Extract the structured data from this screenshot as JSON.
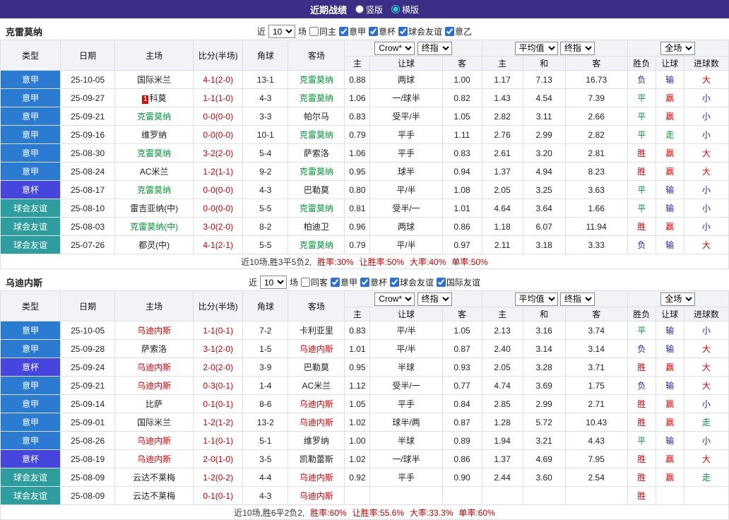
{
  "colors": {
    "topbar_bg": "#3A2E86",
    "type_league": "#2B7BD3",
    "type_cup": "#4646DE",
    "type_friendly": "#2E9D9D",
    "score": "#CC0000",
    "win": "#E60000",
    "draw": "#009933",
    "lose": "#2323CC",
    "focus_section1": "#009933",
    "focus_section2": "#E60000",
    "summary_stat": "#CC0000"
  },
  "topbar": {
    "title": "近期战绩",
    "layout_options": [
      {
        "label": "竖版",
        "selected": false
      },
      {
        "label": "横版",
        "selected": true
      }
    ]
  },
  "table_header": {
    "type": "类型",
    "date": "日期",
    "home": "主场",
    "score": "比分(半场)",
    "corner": "角球",
    "away": "客场",
    "selects": {
      "bookmaker": "Crow*",
      "final1": "终指",
      "average": "平均值",
      "final2": "终指",
      "scope": "全场"
    },
    "sub": [
      "主",
      "让球",
      "客",
      "主",
      "和",
      "客",
      "胜负",
      "让球",
      "进球数"
    ]
  },
  "sections": [
    {
      "team": "克雷莫纳",
      "focus_color_key": "focus_section1",
      "filter": {
        "near": "近",
        "count": "10",
        "games": "场",
        "venue": {
          "label": "同主",
          "checked": false
        },
        "leagues": [
          {
            "label": "意甲",
            "checked": true
          },
          {
            "label": "意杯",
            "checked": true
          },
          {
            "label": "球会友谊",
            "checked": true
          },
          {
            "label": "意乙",
            "checked": true
          }
        ]
      },
      "rows": [
        {
          "type": "意甲",
          "tkey": "league",
          "date": "25-10-05",
          "home": "国际米兰",
          "home_focus": false,
          "badge": "",
          "score": "4-1(2-0)",
          "corner": "13-1",
          "away": "克雷莫纳",
          "away_focus": true,
          "odds": [
            "0.88",
            "两球",
            "1.00",
            "1.17",
            "7.13",
            "16.73"
          ],
          "results": [
            [
              "负",
              "lose"
            ],
            [
              "输",
              "lose"
            ],
            [
              "大",
              "win"
            ]
          ]
        },
        {
          "type": "意甲",
          "tkey": "league",
          "date": "25-09-27",
          "home": "科莫",
          "home_focus": false,
          "badge": "1",
          "score": "1-1(1-0)",
          "corner": "4-3",
          "away": "克雷莫纳",
          "away_focus": true,
          "odds": [
            "1.06",
            "一/球半",
            "0.82",
            "1.43",
            "4.54",
            "7.39"
          ],
          "results": [
            [
              "平",
              "draw"
            ],
            [
              "赢",
              "win"
            ],
            [
              "小",
              "lose"
            ]
          ]
        },
        {
          "type": "意甲",
          "tkey": "league",
          "date": "25-09-21",
          "home": "克雷莫纳",
          "home_focus": true,
          "badge": "",
          "score": "0-0(0-0)",
          "corner": "3-3",
          "away": "帕尔马",
          "away_focus": false,
          "odds": [
            "0.83",
            "受平/半",
            "1.05",
            "2.82",
            "3.11",
            "2.66"
          ],
          "results": [
            [
              "平",
              "draw"
            ],
            [
              "赢",
              "win"
            ],
            [
              "小",
              "lose"
            ]
          ]
        },
        {
          "type": "意甲",
          "tkey": "league",
          "date": "25-09-16",
          "home": "维罗纳",
          "home_focus": false,
          "badge": "",
          "score": "0-0(0-0)",
          "corner": "10-1",
          "away": "克雷莫纳",
          "away_focus": true,
          "odds": [
            "0.79",
            "平手",
            "1.11",
            "2.76",
            "2.99",
            "2.82"
          ],
          "results": [
            [
              "平",
              "draw"
            ],
            [
              "走",
              "draw"
            ],
            [
              "小",
              "lose"
            ]
          ]
        },
        {
          "type": "意甲",
          "tkey": "league",
          "date": "25-08-30",
          "home": "克雷莫纳",
          "home_focus": true,
          "badge": "",
          "score": "3-2(2-0)",
          "corner": "5-4",
          "away": "萨索洛",
          "away_focus": false,
          "odds": [
            "1.06",
            "平手",
            "0.83",
            "2.61",
            "3.20",
            "2.81"
          ],
          "results": [
            [
              "胜",
              "win"
            ],
            [
              "赢",
              "win"
            ],
            [
              "大",
              "win"
            ]
          ]
        },
        {
          "type": "意甲",
          "tkey": "league",
          "date": "25-08-24",
          "home": "AC米兰",
          "home_focus": false,
          "badge": "",
          "score": "1-2(1-1)",
          "corner": "9-2",
          "away": "克雷莫纳",
          "away_focus": true,
          "odds": [
            "0.95",
            "球半",
            "0.94",
            "1.37",
            "4.94",
            "8.23"
          ],
          "results": [
            [
              "胜",
              "win"
            ],
            [
              "赢",
              "win"
            ],
            [
              "大",
              "win"
            ]
          ]
        },
        {
          "type": "意杯",
          "tkey": "cup",
          "date": "25-08-17",
          "home": "克雷莫纳",
          "home_focus": true,
          "badge": "",
          "score": "0-0(0-0)",
          "corner": "4-3",
          "away": "巴勒莫",
          "away_focus": false,
          "odds": [
            "0.80",
            "平/半",
            "1.08",
            "2.05",
            "3.25",
            "3.63"
          ],
          "results": [
            [
              "平",
              "draw"
            ],
            [
              "输",
              "lose"
            ],
            [
              "小",
              "lose"
            ]
          ]
        },
        {
          "type": "球会友谊",
          "tkey": "friendly",
          "date": "25-08-10",
          "home": "雷吉亚纳(中)",
          "home_focus": false,
          "badge": "",
          "score": "0-0(0-0)",
          "corner": "5-5",
          "away": "克雷莫纳",
          "away_focus": true,
          "odds": [
            "0.81",
            "受半/一",
            "1.01",
            "4.64",
            "3.64",
            "1.66"
          ],
          "results": [
            [
              "平",
              "draw"
            ],
            [
              "输",
              "lose"
            ],
            [
              "小",
              "lose"
            ]
          ]
        },
        {
          "type": "球会友谊",
          "tkey": "friendly",
          "date": "25-08-03",
          "home": "克雷莫纳(中)",
          "home_focus": true,
          "badge": "",
          "score": "3-0(2-0)",
          "corner": "8-2",
          "away": "柏迪卫",
          "away_focus": false,
          "odds": [
            "0.96",
            "两球",
            "0.86",
            "1.18",
            "6.07",
            "11.94"
          ],
          "results": [
            [
              "胜",
              "win"
            ],
            [
              "赢",
              "win"
            ],
            [
              "小",
              "lose"
            ]
          ]
        },
        {
          "type": "球会友谊",
          "tkey": "friendly",
          "date": "25-07-26",
          "home": "都灵(中)",
          "home_focus": false,
          "badge": "",
          "score": "4-1(2-1)",
          "corner": "5-5",
          "away": "克雷莫纳",
          "away_focus": true,
          "odds": [
            "0.79",
            "平/半",
            "0.97",
            "2.11",
            "3.18",
            "3.33"
          ],
          "results": [
            [
              "负",
              "lose"
            ],
            [
              "输",
              "lose"
            ],
            [
              "大",
              "win"
            ]
          ]
        }
      ],
      "summary": {
        "prefix": "近10场,胜3平5负2,",
        "stats": [
          "胜率:30%",
          "让胜率:50%",
          "大率:40%",
          "单率:50%"
        ]
      }
    },
    {
      "team": "乌迪内斯",
      "focus_color_key": "focus_section2",
      "filter": {
        "near": "近",
        "count": "10",
        "games": "场",
        "venue": {
          "label": "同客",
          "checked": false
        },
        "leagues": [
          {
            "label": "意甲",
            "checked": true
          },
          {
            "label": "意杯",
            "checked": true
          },
          {
            "label": "球会友谊",
            "checked": true
          },
          {
            "label": "国际友谊",
            "checked": true
          }
        ]
      },
      "rows": [
        {
          "type": "意甲",
          "tkey": "league",
          "date": "25-10-05",
          "home": "乌迪内斯",
          "home_focus": true,
          "badge": "",
          "score": "1-1(0-1)",
          "corner": "7-2",
          "away": "卡利亚里",
          "away_focus": false,
          "odds": [
            "0.83",
            "平/半",
            "1.05",
            "2.13",
            "3.16",
            "3.74"
          ],
          "results": [
            [
              "平",
              "draw"
            ],
            [
              "输",
              "lose"
            ],
            [
              "小",
              "lose"
            ]
          ]
        },
        {
          "type": "意甲",
          "tkey": "league",
          "date": "25-09-28",
          "home": "萨索洛",
          "home_focus": false,
          "badge": "",
          "score": "3-1(2-0)",
          "corner": "1-5",
          "away": "乌迪内斯",
          "away_focus": true,
          "odds": [
            "1.01",
            "平/半",
            "0.87",
            "2.40",
            "3.14",
            "3.14"
          ],
          "results": [
            [
              "负",
              "lose"
            ],
            [
              "输",
              "lose"
            ],
            [
              "大",
              "win"
            ]
          ]
        },
        {
          "type": "意杯",
          "tkey": "cup",
          "date": "25-09-24",
          "home": "乌迪内斯",
          "home_focus": true,
          "badge": "",
          "score": "2-0(2-0)",
          "corner": "3-9",
          "away": "巴勒莫",
          "away_focus": false,
          "odds": [
            "0.95",
            "半球",
            "0.93",
            "2.05",
            "3.28",
            "3.71"
          ],
          "results": [
            [
              "胜",
              "win"
            ],
            [
              "赢",
              "win"
            ],
            [
              "大",
              "win"
            ]
          ]
        },
        {
          "type": "意甲",
          "tkey": "league",
          "date": "25-09-21",
          "home": "乌迪内斯",
          "home_focus": true,
          "badge": "",
          "score": "0-3(0-1)",
          "corner": "1-4",
          "away": "AC米兰",
          "away_focus": false,
          "odds": [
            "1.12",
            "受半/一",
            "0.77",
            "4.74",
            "3.69",
            "1.75"
          ],
          "results": [
            [
              "负",
              "lose"
            ],
            [
              "输",
              "lose"
            ],
            [
              "大",
              "win"
            ]
          ]
        },
        {
          "type": "意甲",
          "tkey": "league",
          "date": "25-09-14",
          "home": "比萨",
          "home_focus": false,
          "badge": "",
          "score": "0-1(0-1)",
          "corner": "8-6",
          "away": "乌迪内斯",
          "away_focus": true,
          "odds": [
            "1.05",
            "平手",
            "0.84",
            "2.85",
            "2.99",
            "2.71"
          ],
          "results": [
            [
              "胜",
              "win"
            ],
            [
              "赢",
              "win"
            ],
            [
              "小",
              "lose"
            ]
          ]
        },
        {
          "type": "意甲",
          "tkey": "league",
          "date": "25-09-01",
          "home": "国际米兰",
          "home_focus": false,
          "badge": "",
          "score": "1-2(1-2)",
          "corner": "13-2",
          "away": "乌迪内斯",
          "away_focus": true,
          "odds": [
            "1.02",
            "球半/两",
            "0.87",
            "1.28",
            "5.72",
            "10.43"
          ],
          "results": [
            [
              "胜",
              "win"
            ],
            [
              "赢",
              "win"
            ],
            [
              "走",
              "draw"
            ]
          ]
        },
        {
          "type": "意甲",
          "tkey": "league",
          "date": "25-08-26",
          "home": "乌迪内斯",
          "home_focus": true,
          "badge": "",
          "score": "1-1(0-1)",
          "corner": "5-1",
          "away": "维罗纳",
          "away_focus": false,
          "odds": [
            "1.00",
            "半球",
            "0.89",
            "1.94",
            "3.21",
            "4.43"
          ],
          "results": [
            [
              "平",
              "draw"
            ],
            [
              "输",
              "lose"
            ],
            [
              "小",
              "lose"
            ]
          ]
        },
        {
          "type": "意杯",
          "tkey": "cup",
          "date": "25-08-19",
          "home": "乌迪内斯",
          "home_focus": true,
          "badge": "",
          "score": "2-0(1-0)",
          "corner": "3-5",
          "away": "凯勒蕾斯",
          "away_focus": false,
          "odds": [
            "1.02",
            "一/球半",
            "0.86",
            "1.37",
            "4.69",
            "7.95"
          ],
          "results": [
            [
              "胜",
              "win"
            ],
            [
              "赢",
              "win"
            ],
            [
              "大",
              "win"
            ]
          ]
        },
        {
          "type": "球会友谊",
          "tkey": "friendly",
          "date": "25-08-09",
          "home": "云达不莱梅",
          "home_focus": false,
          "badge": "",
          "score": "1-2(0-2)",
          "corner": "4-4",
          "away": "乌迪内斯",
          "away_focus": true,
          "odds": [
            "0.92",
            "平手",
            "0.90",
            "2.44",
            "3.60",
            "2.54"
          ],
          "results": [
            [
              "胜",
              "win"
            ],
            [
              "赢",
              "win"
            ],
            [
              "走",
              "draw"
            ]
          ]
        },
        {
          "type": "球会友谊",
          "tkey": "friendly",
          "date": "25-08-09",
          "home": "云达不莱梅",
          "home_focus": false,
          "badge": "",
          "score": "0-1(0-1)",
          "corner": "4-3",
          "away": "乌迪内斯",
          "away_focus": true,
          "odds": [
            "",
            "",
            "",
            "",
            "",
            ""
          ],
          "results": [
            [
              "胜",
              "win"
            ],
            [
              "",
              ""
            ],
            [
              "",
              ""
            ]
          ]
        }
      ],
      "summary": {
        "prefix": "近10场,胜6平2负2,",
        "stats": [
          "胜率:60%",
          "让胜率:55.6%",
          "大率:33.3%",
          "单率:60%"
        ]
      }
    }
  ]
}
